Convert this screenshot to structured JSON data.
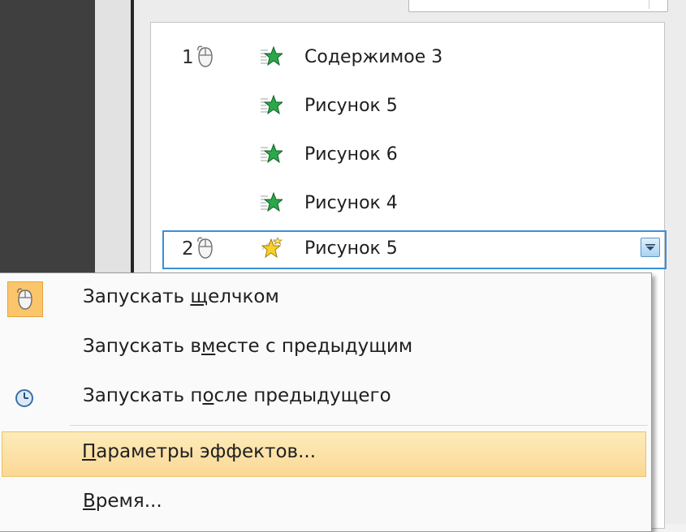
{
  "animation_pane": {
    "items": [
      {
        "number": "1",
        "trigger_icon": "mouse-icon",
        "effect_icon": "green-star-entrance-icon",
        "label": "Содержимое 3"
      },
      {
        "number": "",
        "trigger_icon": "",
        "effect_icon": "green-star-entrance-icon",
        "label": "Рисунок 5"
      },
      {
        "number": "",
        "trigger_icon": "",
        "effect_icon": "green-star-entrance-icon",
        "label": "Рисунок 6"
      },
      {
        "number": "",
        "trigger_icon": "",
        "effect_icon": "green-star-entrance-icon",
        "label": "Рисунок 4"
      },
      {
        "number": "2",
        "trigger_icon": "mouse-icon",
        "effect_icon": "yellow-star-emphasis-icon",
        "label": "Рисунок 5",
        "selected": true
      }
    ]
  },
  "context_menu": {
    "items": [
      {
        "label_pre": "Запускать ",
        "label_ul": "щ",
        "label_post": "елчком",
        "icon": "mouse-icon",
        "checked": true
      },
      {
        "label_pre": "Запускать в",
        "label_ul": "м",
        "label_post": "есте с предыдущим",
        "icon": ""
      },
      {
        "label_pre": "Запускать п",
        "label_ul": "о",
        "label_post": "сле предыдущего",
        "icon": "clock-icon"
      },
      {
        "label_pre": "",
        "label_ul": "П",
        "label_post": "араметры эффектов...",
        "icon": "",
        "highlighted": true
      },
      {
        "label_pre": "",
        "label_ul": "В",
        "label_post": "ремя...",
        "icon": ""
      }
    ]
  },
  "colors": {
    "selection_border": "#3c8fd8",
    "menu_highlight": "#fbd894",
    "checked_highlight": "#fbc56b",
    "effect_green": "#1f8a3a",
    "effect_yellow": "#f2c21b"
  }
}
